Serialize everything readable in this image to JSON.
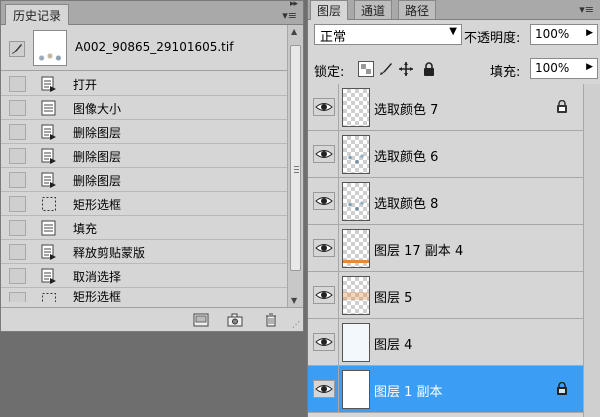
{
  "history_panel": {
    "tabs": [
      {
        "label": "历史记录",
        "active": true
      }
    ],
    "snapshot": {
      "name": "A002_90865_29101605.tif"
    },
    "items": [
      {
        "label": "打开",
        "icon": "history-step-icon"
      },
      {
        "label": "图像大小",
        "icon": "history-list-icon"
      },
      {
        "label": "删除图层",
        "icon": "history-step-icon"
      },
      {
        "label": "删除图层",
        "icon": "history-step-icon"
      },
      {
        "label": "删除图层",
        "icon": "history-step-icon"
      },
      {
        "label": "矩形选框",
        "icon": "marquee-icon"
      },
      {
        "label": "填充",
        "icon": "history-list-icon"
      },
      {
        "label": "释放剪贴蒙版",
        "icon": "history-step-icon"
      },
      {
        "label": "取消选择",
        "icon": "history-step-icon"
      },
      {
        "label": "矩形选框",
        "icon": "marquee-icon"
      }
    ]
  },
  "layers_panel": {
    "tabs": [
      {
        "label": "图层",
        "active": true
      },
      {
        "label": "通道",
        "active": false
      },
      {
        "label": "路径",
        "active": false
      }
    ],
    "blend_mode": "正常",
    "opacity_label": "不透明度:",
    "opacity_value": "100%",
    "lock_label": "锁定:",
    "fill_label": "填充:",
    "fill_value": "100%",
    "layers": [
      {
        "name": "选取颜色 7",
        "locked": true,
        "selected": false
      },
      {
        "name": "选取颜色 6",
        "locked": false,
        "selected": false
      },
      {
        "name": "选取颜色 8",
        "locked": false,
        "selected": false
      },
      {
        "name": "图层 17 副本 4",
        "locked": false,
        "selected": false
      },
      {
        "name": "图层 5",
        "locked": false,
        "selected": false
      },
      {
        "name": "图层 4",
        "locked": false,
        "selected": false
      },
      {
        "name": "图层 1 副本",
        "locked": true,
        "selected": true
      }
    ]
  },
  "colors": {
    "selection": "#3b9df4",
    "panel_bg": "#d6d6d6",
    "tab_bg": "#a9a9a9"
  }
}
